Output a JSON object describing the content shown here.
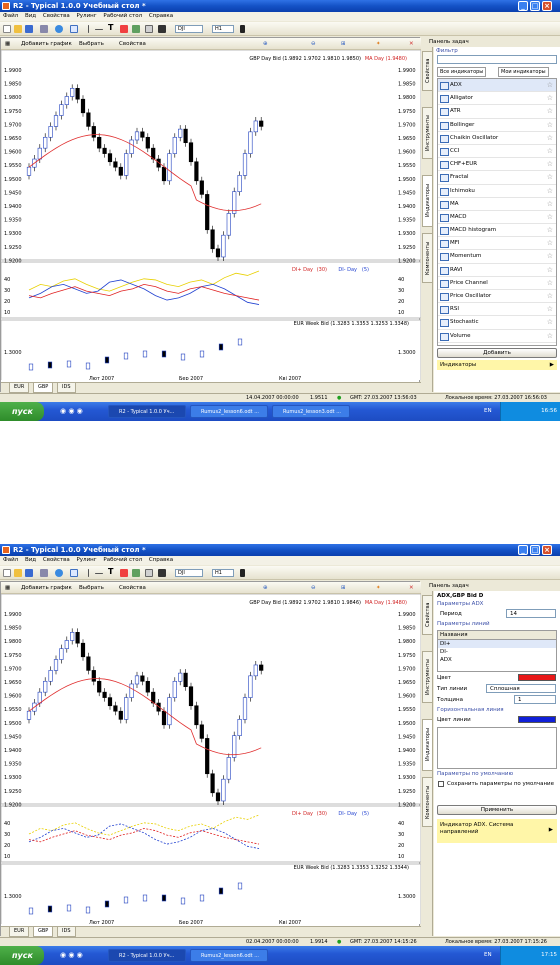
{
  "window": {
    "title": "R2 - Typical 1.0.0 Учебный стол *",
    "min": "_",
    "max": "□",
    "close": "×"
  },
  "menu": [
    "Файл",
    "Вид",
    "Свойства",
    "Рулинг",
    "Рабочий стол",
    "Справка"
  ],
  "toolbar": {
    "symbol": "DJI",
    "timeframe": "H1"
  },
  "chart_toolbar": {
    "add_chart": "Добавить график",
    "select": "Выбрать",
    "properties": "Свойства"
  },
  "task_panel_title": "Панель задач",
  "vtabs": [
    "Свойства",
    "Инструменты",
    "Индикаторы",
    "Компоненты"
  ],
  "top": {
    "main_legend": "GBP Day Bid (1.9892 1.9702 1.9810 1.9850)",
    "main_ma": "MA Day (1.9480)",
    "main_yticks": [
      "1.9900",
      "1.9850",
      "1.9800",
      "1.9750",
      "1.9700",
      "1.9650",
      "1.9600",
      "1.9550",
      "1.9500",
      "1.9450",
      "1.9400",
      "1.9350",
      "1.9300",
      "1.9250",
      "1.9200"
    ],
    "adx_legend_1": "DI+ Day",
    "adx_legend_2": "(30)",
    "adx_legend_3": "DI- Day",
    "adx_legend_4": "(5)",
    "adx_yticks": [
      "40",
      "30",
      "20",
      "10"
    ],
    "eur_legend": "EUR Week Bid (1.3283 1.3353 1.3253 1.3348)",
    "eur_ytick": "1.3000",
    "xticks": [
      "Лют 2007",
      "Бер 2007",
      "Квi 2007"
    ],
    "tabs": [
      "EUR",
      "GBP",
      "IDS"
    ],
    "filter_label": "Фильтр",
    "panel_tabs": [
      "Все индикаторы",
      "Мои индикаторы"
    ],
    "indicators": [
      "ADX",
      "Alligator",
      "ATR",
      "Bollinger",
      "Chaikin Oscillator",
      "CCI",
      "CHF+EUR",
      "Fractal",
      "Ichimoku",
      "MA",
      "MACD",
      "MACD histogram",
      "MFI",
      "Momentum",
      "RAVI",
      "Price Channel",
      "Price Oscillator",
      "RSI",
      "Stochastic",
      "Volume"
    ],
    "add_button": "Добавить",
    "bottom_section": "Индикаторы",
    "status": {
      "time": "14.04.2007 00:00:00",
      "price": "1.9511",
      "gmt": "GMT: 27.03.2007 13:56:03",
      "local": "Локальное время: 27.03.2007 16:56:03"
    },
    "task": [
      "R2 - Typical 1.0.0 Уч...",
      "Rumus2_lesson6.odt ...",
      "Rumus2_lesson3.odt ..."
    ],
    "tray": {
      "lang": "EN",
      "clock": "16:56"
    }
  },
  "bottom": {
    "main_legend": "GBP Day Bid (1.9892 1.9702 1.9810 1.9846)",
    "main_ma": "MA Day (1.9480)",
    "main_yticks": [
      "1.9900",
      "1.9850",
      "1.9800",
      "1.9750",
      "1.9700",
      "1.9650",
      "1.9600",
      "1.9550",
      "1.9500",
      "1.9450",
      "1.9400",
      "1.9350",
      "1.9300",
      "1.9250",
      "1.9200"
    ],
    "adx_legend_1": "DI+ Day",
    "adx_legend_2": "(30)",
    "adx_legend_3": "DI- Day",
    "adx_legend_4": "(5)",
    "adx_yticks": [
      "40",
      "30",
      "20",
      "10"
    ],
    "eur_legend": "EUR Week Bid (1.3283 1.3353 1.3252 1.3344)",
    "eur_ytick": "1.3000",
    "xticks": [
      "Лют 2007",
      "Бер 2007",
      "Квi 2007"
    ],
    "tabs": [
      "EUR",
      "GBP",
      "IDS"
    ],
    "props_title": "ADX,GBP Bid D",
    "adx_params": "Параметры ADX",
    "period_label": "Период",
    "period_value": "14",
    "line_params": "Параметры линий",
    "names_header": "Названия",
    "line_names": [
      "DI+",
      "DI-",
      "ADX"
    ],
    "color_label": "Цвет",
    "line_type_label": "Тип линии",
    "line_type_value": "Сплошная",
    "thickness_label": "Толщина",
    "thickness_value": "1",
    "hline_section": "Горизонтальная линия",
    "hline_color": "Цвет линии",
    "defaults_section": "Параметры по умолчанию",
    "save_defaults": "Сохранить параметры по умолчание",
    "apply_button": "Применить",
    "hint": "Индикатор ADX. Система направлений",
    "status": {
      "time": "02.04.2007 00:00:00",
      "price": "1.9914",
      "gmt": "GMT: 27.03.2007 14:15:26",
      "local": "Локальное время: 27.03.2007 17:15:26"
    },
    "task": [
      "R2 - Typical 1.0.0 Уч...",
      "Rumus2_lesson6.odt ..."
    ],
    "tray": {
      "lang": "EN",
      "clock": "17:15"
    }
  },
  "start_label": "пуск",
  "colors": {
    "di_plus": "#e8d000",
    "di_minus": "#2040d0",
    "adx": "#e02020",
    "ma": "#e03030",
    "xp_blue": "#245edb"
  }
}
